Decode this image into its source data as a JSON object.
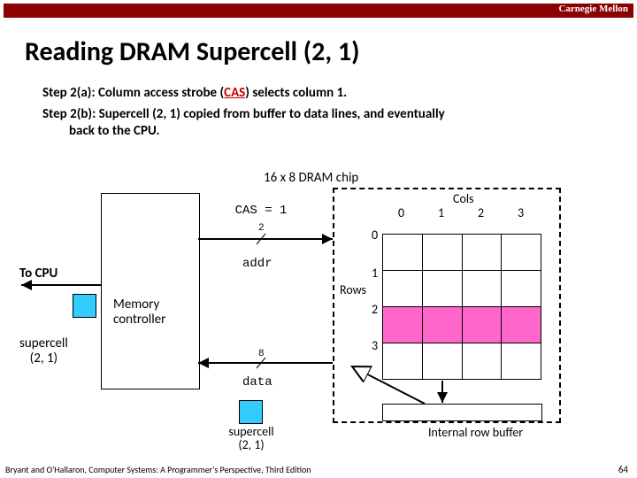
{
  "brand": "Carnegie Mellon",
  "title": "Reading DRAM Supercell (2, 1)",
  "steps": {
    "a_pre": "Step 2(a): Column access strobe (",
    "a_cas": "CAS",
    "a_post": ") selects column 1.",
    "b_line1": "Step 2(b): Supercell (2, 1) copied from buffer to data lines, and eventually",
    "b_line2": "back to the CPU."
  },
  "chip_label": "16 x 8 DRAM chip",
  "cas_signal": "CAS = 1",
  "bus_addr_width": "2",
  "bus_data_width": "8",
  "addr_label": "addr",
  "data_label": "data",
  "to_cpu": "To CPU",
  "mem_controller_l1": "Memory",
  "mem_controller_l2": "controller",
  "supercell_l1": "supercell",
  "supercell_l2": "(2, 1)",
  "cols_label": "Cols",
  "rows_label": "Rows",
  "col_nums": {
    "c0": "0",
    "c1": "1",
    "c2": "2",
    "c3": "3"
  },
  "row_nums": {
    "r0": "0",
    "r1": "1",
    "r2": "2",
    "r3": "3"
  },
  "row_buffer_label": "Internal row buffer",
  "supercell_out_l1": "supercell",
  "supercell_out_l2": "(2, 1)",
  "footer_left": "Bryant and O'Hallaron, Computer Systems: A Programmer's Perspective, Third Edition",
  "footer_right": "64"
}
